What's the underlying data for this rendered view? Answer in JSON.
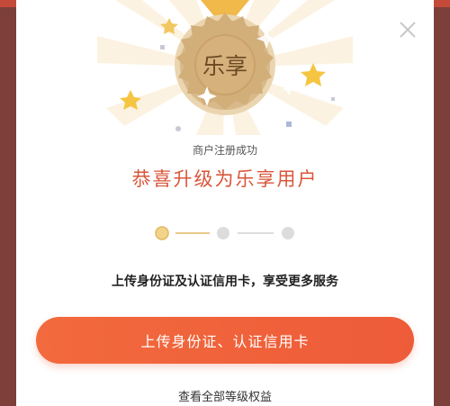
{
  "dialog": {
    "badge_text": "乐享",
    "subtitle": "商户注册成功",
    "title": "恭喜升级为乐享用户",
    "description": "上传身份证及认证信用卡，享受更多服务",
    "cta_label": "上传身份证、认证信用卡",
    "link_label": "查看全部等级权益",
    "close_icon": "close-icon"
  },
  "steps": {
    "total": 3,
    "current": 1
  },
  "colors": {
    "accent": "#ee5b39",
    "title": "#d9563b",
    "medal": "#d6b17c",
    "star": "#f5c542"
  }
}
